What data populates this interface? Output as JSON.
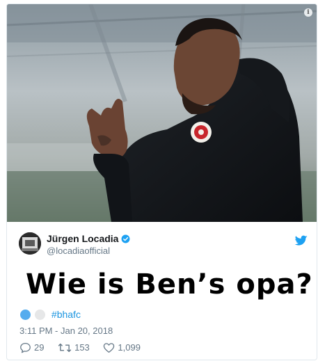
{
  "tweet": {
    "author_name": "Jürgen Locadia",
    "handle": "@locadiaofficial",
    "text": "Wie is Ben’s opa?",
    "hashtag": "#bhafc",
    "timestamp": "3:11 PM - Jan 20, 2018",
    "replies": "29",
    "retweets": "153",
    "likes": "1,099",
    "verified": true
  },
  "media": {
    "info_label": "i"
  },
  "colors": {
    "link": "#1b95e0",
    "muted": "#657786",
    "verified": "#1da1f2",
    "border": "#e1e8ed"
  },
  "icons": [
    "info-icon",
    "verified-badge-icon",
    "twitter-bird-icon",
    "blue-circle-emoji",
    "white-circle-emoji",
    "reply-icon",
    "retweet-icon",
    "heart-icon"
  ]
}
